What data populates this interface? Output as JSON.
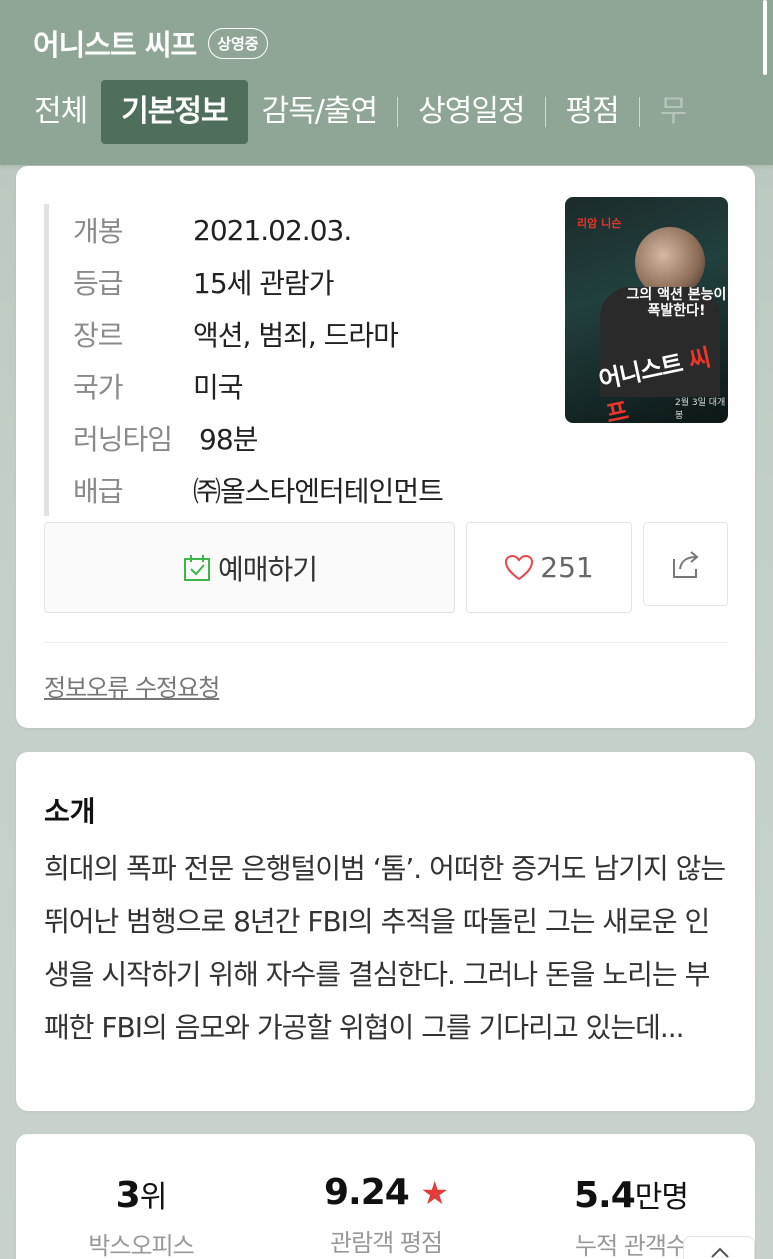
{
  "header": {
    "title": "어니스트 씨프",
    "badge": "상영중",
    "tabs": [
      {
        "label": "전체"
      },
      {
        "label": "기본정보"
      },
      {
        "label": "감독/출연"
      },
      {
        "label": "상영일정"
      },
      {
        "label": "평점"
      },
      {
        "label": "무"
      }
    ]
  },
  "info": {
    "rows": [
      {
        "label": "개봉",
        "value": "2021.02.03."
      },
      {
        "label": "등급",
        "value": "15세 관람가"
      },
      {
        "label": "장르",
        "value": "액션, 범죄, 드라마"
      },
      {
        "label": "국가",
        "value": "미국"
      },
      {
        "label": "러닝타임",
        "value": "98분"
      },
      {
        "label": "배급",
        "value": "㈜올스타엔터테인먼트"
      }
    ],
    "reserve_label": "예매하기",
    "like_count": "251",
    "error_link": "정보오류 수정요청"
  },
  "poster": {
    "top_text": "리암 니슨",
    "tagline": "그의 액션 본능이 폭발한다!",
    "title_main": "어니스트",
    "title_accent": "씨프",
    "date": "2월 3일 대개봉"
  },
  "intro": {
    "title": "소개",
    "text": "희대의 폭파 전문 은행털이범 ‘톰’. 어떠한 증거도 남기지 않는 뛰어난 범행으로 8년간 FBI의 추적을 따돌린 그는 새로운 인생을 시작하기 위해 자수를 결심한다. 그러나 돈을 노리는 부패한 FBI의 음모와 가공할 위협이 그를 기다리고 있는데..."
  },
  "stats": [
    {
      "value": "3",
      "unit": "위",
      "label": "박스오피스"
    },
    {
      "value": "9.24",
      "unit": "★",
      "label": "관람객 평점"
    },
    {
      "value": "5.4",
      "unit": "만명",
      "label": "누적 관객수"
    }
  ],
  "colors": {
    "header_bg": "#8fa596",
    "active_tab_bg": "#4f6e5c",
    "reserve_icon": "#3cb54a",
    "heart": "#e5484d",
    "star": "#e23d3d"
  },
  "icons": {
    "reserve": "calendar-check-icon",
    "like": "heart-icon",
    "share": "share-icon"
  }
}
